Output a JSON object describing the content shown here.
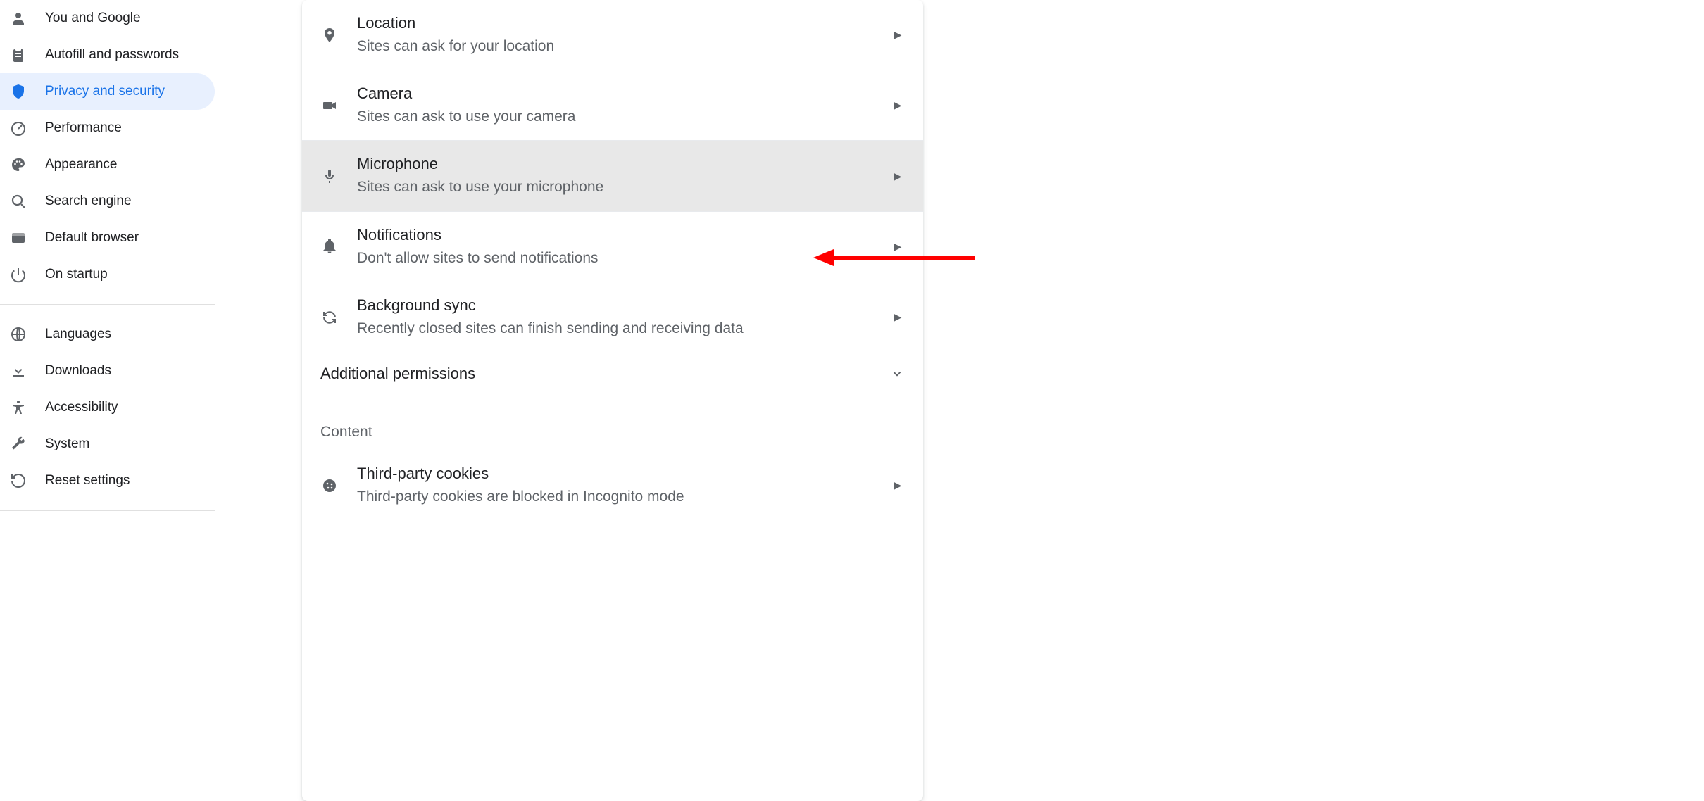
{
  "sidebar": {
    "items": [
      {
        "id": "you-google",
        "label": "You and Google",
        "icon": "person-icon",
        "active": false
      },
      {
        "id": "autofill",
        "label": "Autofill and passwords",
        "icon": "clipboard-icon",
        "active": false
      },
      {
        "id": "privacy",
        "label": "Privacy and security",
        "icon": "shield-icon",
        "active": true
      },
      {
        "id": "performance",
        "label": "Performance",
        "icon": "speedometer-icon",
        "active": false
      },
      {
        "id": "appearance",
        "label": "Appearance",
        "icon": "palette-icon",
        "active": false
      },
      {
        "id": "search",
        "label": "Search engine",
        "icon": "search-icon",
        "active": false
      },
      {
        "id": "default",
        "label": "Default browser",
        "icon": "browser-icon",
        "active": false
      },
      {
        "id": "startup",
        "label": "On startup",
        "icon": "power-icon",
        "active": false
      }
    ],
    "secondary": [
      {
        "id": "languages",
        "label": "Languages",
        "icon": "globe-icon"
      },
      {
        "id": "downloads",
        "label": "Downloads",
        "icon": "download-icon"
      },
      {
        "id": "accessibility",
        "label": "Accessibility",
        "icon": "accessibility-icon"
      },
      {
        "id": "system",
        "label": "System",
        "icon": "wrench-icon"
      },
      {
        "id": "reset",
        "label": "Reset settings",
        "icon": "restore-icon"
      }
    ]
  },
  "permissions": {
    "rows": [
      {
        "id": "location",
        "title": "Location",
        "sub": "Sites can ask for your location",
        "icon": "location-icon",
        "hovered": false
      },
      {
        "id": "camera",
        "title": "Camera",
        "sub": "Sites can ask to use your camera",
        "icon": "camera-icon",
        "hovered": false
      },
      {
        "id": "microphone",
        "title": "Microphone",
        "sub": "Sites can ask to use your microphone",
        "icon": "mic-icon",
        "hovered": true
      },
      {
        "id": "notifications",
        "title": "Notifications",
        "sub": "Don't allow sites to send notifications",
        "icon": "bell-icon",
        "hovered": false
      },
      {
        "id": "bgsync",
        "title": "Background sync",
        "sub": "Recently closed sites can finish sending and receiving data",
        "icon": "sync-icon",
        "hovered": false
      }
    ],
    "additional_label": "Additional permissions"
  },
  "content_section": {
    "header": "Content",
    "rows": [
      {
        "id": "cookies",
        "title": "Third-party cookies",
        "sub": "Third-party cookies are blocked in Incognito mode",
        "icon": "cookie-icon"
      }
    ]
  },
  "annotation": {
    "kind": "arrow",
    "color": "#ff0000"
  }
}
